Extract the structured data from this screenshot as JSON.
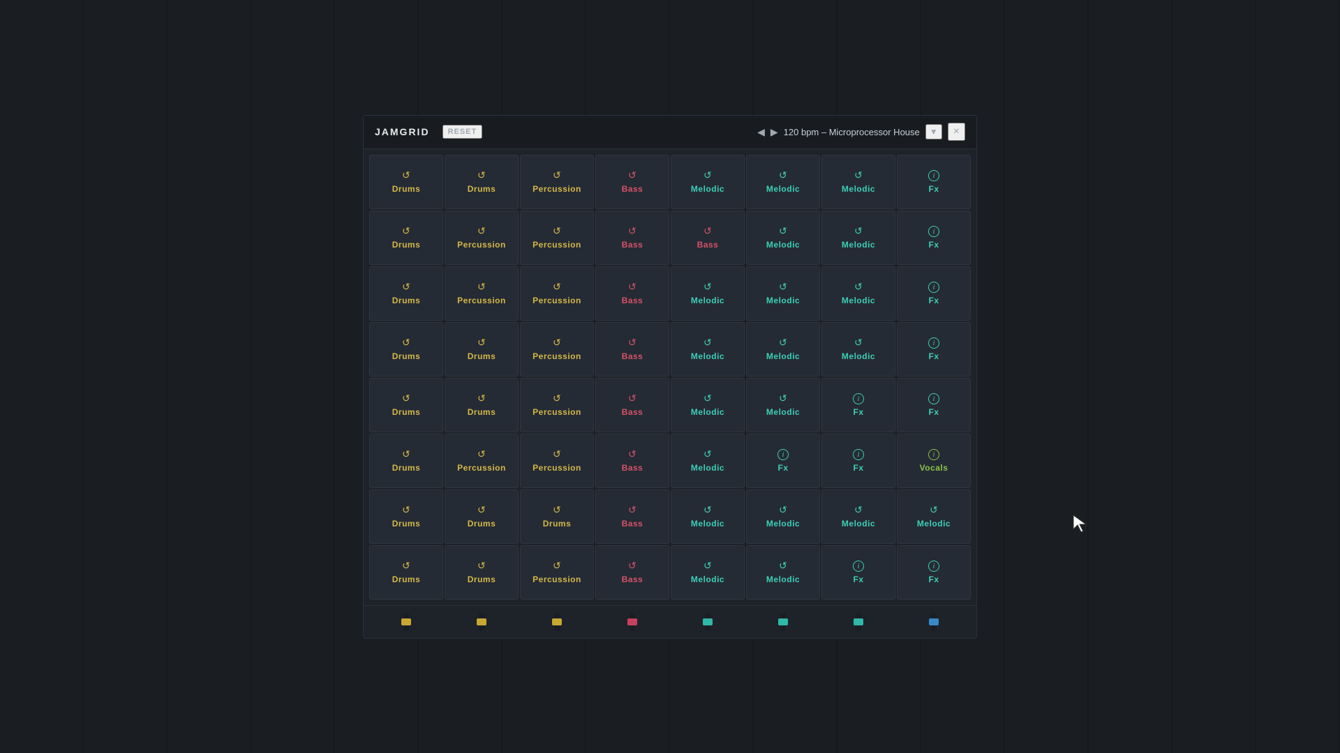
{
  "app": {
    "name": "JAMGRID",
    "reset_label": "RESET",
    "bpm": "120 bpm – Microprocessor House",
    "close_label": "×"
  },
  "colors": {
    "drums": "#d4b84a",
    "percussion": "#d4b84a",
    "bass": "#d4526a",
    "melodic": "#3ecfb8",
    "fx": "#3ecfb8",
    "vocals": "#8bc34a"
  },
  "grid": {
    "rows": [
      [
        {
          "type": "drums",
          "label": "Drums",
          "icon": "refresh"
        },
        {
          "type": "drums",
          "label": "Drums",
          "icon": "refresh"
        },
        {
          "type": "percussion",
          "label": "Percussion",
          "icon": "refresh"
        },
        {
          "type": "bass",
          "label": "Bass",
          "icon": "refresh"
        },
        {
          "type": "melodic",
          "label": "Melodic",
          "icon": "refresh"
        },
        {
          "type": "melodic",
          "label": "Melodic",
          "icon": "refresh"
        },
        {
          "type": "melodic",
          "label": "Melodic",
          "icon": "refresh"
        },
        {
          "type": "fx",
          "label": "Fx",
          "icon": "info"
        }
      ],
      [
        {
          "type": "drums",
          "label": "Drums",
          "icon": "refresh"
        },
        {
          "type": "percussion",
          "label": "Percussion",
          "icon": "refresh"
        },
        {
          "type": "percussion",
          "label": "Percussion",
          "icon": "refresh"
        },
        {
          "type": "bass",
          "label": "Bass",
          "icon": "refresh"
        },
        {
          "type": "bass",
          "label": "Bass",
          "icon": "refresh"
        },
        {
          "type": "melodic",
          "label": "Melodic",
          "icon": "refresh"
        },
        {
          "type": "melodic",
          "label": "Melodic",
          "icon": "refresh"
        },
        {
          "type": "fx",
          "label": "Fx",
          "icon": "info"
        }
      ],
      [
        {
          "type": "drums",
          "label": "Drums",
          "icon": "refresh"
        },
        {
          "type": "percussion",
          "label": "Percussion",
          "icon": "refresh"
        },
        {
          "type": "percussion",
          "label": "Percussion",
          "icon": "refresh"
        },
        {
          "type": "bass",
          "label": "Bass",
          "icon": "refresh"
        },
        {
          "type": "melodic",
          "label": "Melodic",
          "icon": "refresh"
        },
        {
          "type": "melodic",
          "label": "Melodic",
          "icon": "refresh"
        },
        {
          "type": "melodic",
          "label": "Melodic",
          "icon": "refresh"
        },
        {
          "type": "fx",
          "label": "Fx",
          "icon": "info"
        }
      ],
      [
        {
          "type": "drums",
          "label": "Drums",
          "icon": "refresh"
        },
        {
          "type": "drums",
          "label": "Drums",
          "icon": "refresh"
        },
        {
          "type": "percussion",
          "label": "Percussion",
          "icon": "refresh"
        },
        {
          "type": "bass",
          "label": "Bass",
          "icon": "refresh"
        },
        {
          "type": "melodic",
          "label": "Melodic",
          "icon": "refresh"
        },
        {
          "type": "melodic",
          "label": "Melodic",
          "icon": "refresh"
        },
        {
          "type": "melodic",
          "label": "Melodic",
          "icon": "refresh"
        },
        {
          "type": "fx",
          "label": "Fx",
          "icon": "info"
        }
      ],
      [
        {
          "type": "drums",
          "label": "Drums",
          "icon": "refresh"
        },
        {
          "type": "drums",
          "label": "Drums",
          "icon": "refresh"
        },
        {
          "type": "percussion",
          "label": "Percussion",
          "icon": "refresh"
        },
        {
          "type": "bass",
          "label": "Bass",
          "icon": "refresh"
        },
        {
          "type": "melodic",
          "label": "Melodic",
          "icon": "refresh"
        },
        {
          "type": "melodic",
          "label": "Melodic",
          "icon": "refresh"
        },
        {
          "type": "fx",
          "label": "Fx",
          "icon": "info"
        },
        {
          "type": "fx",
          "label": "Fx",
          "icon": "info"
        }
      ],
      [
        {
          "type": "drums",
          "label": "Drums",
          "icon": "refresh"
        },
        {
          "type": "percussion",
          "label": "Percussion",
          "icon": "refresh"
        },
        {
          "type": "percussion",
          "label": "Percussion",
          "icon": "refresh"
        },
        {
          "type": "bass",
          "label": "Bass",
          "icon": "refresh"
        },
        {
          "type": "melodic",
          "label": "Melodic",
          "icon": "refresh"
        },
        {
          "type": "fx",
          "label": "Fx",
          "icon": "info"
        },
        {
          "type": "fx",
          "label": "Fx",
          "icon": "info"
        },
        {
          "type": "vocals",
          "label": "Vocals",
          "icon": "info"
        }
      ],
      [
        {
          "type": "drums",
          "label": "Drums",
          "icon": "refresh"
        },
        {
          "type": "drums",
          "label": "Drums",
          "icon": "refresh"
        },
        {
          "type": "drums",
          "label": "Drums",
          "icon": "refresh"
        },
        {
          "type": "bass",
          "label": "Bass",
          "icon": "refresh"
        },
        {
          "type": "melodic",
          "label": "Melodic",
          "icon": "refresh"
        },
        {
          "type": "melodic",
          "label": "Melodic",
          "icon": "refresh"
        },
        {
          "type": "melodic",
          "label": "Melodic",
          "icon": "refresh"
        },
        {
          "type": "melodic",
          "label": "Melodic",
          "icon": "refresh"
        }
      ],
      [
        {
          "type": "drums",
          "label": "Drums",
          "icon": "refresh"
        },
        {
          "type": "drums",
          "label": "Drums",
          "icon": "refresh"
        },
        {
          "type": "percussion",
          "label": "Percussion",
          "icon": "refresh"
        },
        {
          "type": "bass",
          "label": "Bass",
          "icon": "refresh"
        },
        {
          "type": "melodic",
          "label": "Melodic",
          "icon": "refresh"
        },
        {
          "type": "melodic",
          "label": "Melodic",
          "icon": "refresh"
        },
        {
          "type": "fx",
          "label": "Fx",
          "icon": "info"
        },
        {
          "type": "fx",
          "label": "Fx",
          "icon": "info"
        }
      ]
    ]
  },
  "faders": [
    {
      "color": "yellow",
      "position": 0.5
    },
    {
      "color": "yellow",
      "position": 0.5
    },
    {
      "color": "yellow",
      "position": 0.5
    },
    {
      "color": "pink",
      "position": 0.5
    },
    {
      "color": "teal",
      "position": 0.5
    },
    {
      "color": "teal",
      "position": 0.5
    },
    {
      "color": "teal",
      "position": 0.5
    },
    {
      "color": "blue",
      "position": 0.5
    }
  ]
}
